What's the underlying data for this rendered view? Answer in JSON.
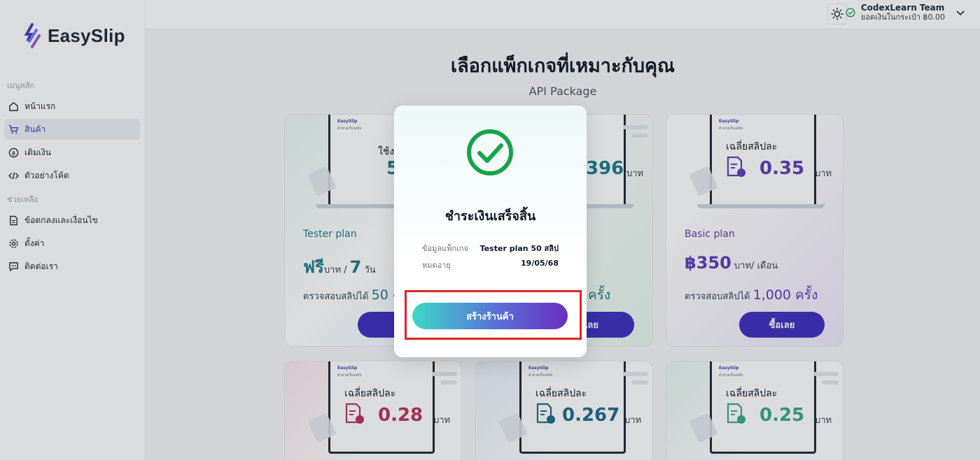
{
  "app": {
    "brand": "EasySlip"
  },
  "sidebar": {
    "sections": [
      {
        "title": "เมนูหลัก"
      },
      {
        "title": "ช่วยเหลือ"
      }
    ],
    "items": [
      {
        "label": "หน้าแรก",
        "icon": "home-icon"
      },
      {
        "label": "สินค้า",
        "icon": "cart-icon",
        "active": true
      },
      {
        "label": "เติมเงิน",
        "icon": "coin-icon"
      },
      {
        "label": "ตัวอย่างโค้ด",
        "icon": "code-icon"
      },
      {
        "label": "ข้อตกลงและเงื่อนไข",
        "icon": "document-icon"
      },
      {
        "label": "ตั้งค่า",
        "icon": "gear-icon"
      },
      {
        "label": "ติดต่อเรา",
        "icon": "chat-icon"
      }
    ]
  },
  "header": {
    "user_name": "CodexLearn Team",
    "balance": "ยอดเงินในกระเป๋า ฿0.00"
  },
  "main": {
    "title": "เลือกแพ็กเกจที่เหมาะกับคุณ",
    "subtitle": "API Package",
    "cards": [
      {
        "mini_logo": "EasySlip",
        "mini_sub": "ตัวช่วยเรื่องสลิป",
        "screen_text": "ใช้งา",
        "screen_value": "5",
        "plan_name": "Tester plan",
        "price": "ฟรี",
        "price_unit": "บาท / ",
        "price_period_value": "7",
        "price_period": " วัน",
        "check_prefix": "ตรวจสอบสลิปได้ ",
        "check_value": "50 ค",
        "buy": "ซื้"
      },
      {
        "screen_value": "396",
        "screen_unit": "บาท",
        "check_value": "ครั้ง",
        "buy": "เลย"
      },
      {
        "mini_logo": "EasySlip",
        "mini_sub": "ตัวช่วยเรื่องสลิป",
        "avg_label": "เฉลี่ยสลิปละ",
        "avg_value": "0.35",
        "avg_unit": "บาท",
        "plan_name": "Basic plan",
        "price": "฿350",
        "price_unit": " บาท/ เดือน",
        "check_prefix": "ตรวจสอบสลิปได้ ",
        "check_value": "1,000 ครั้ง",
        "buy": "ซื้อเลย"
      },
      {
        "mini_logo": "EasySlip",
        "mini_sub": "ตัวช่วยเรื่องสลิป",
        "avg_label": "เฉลี่ยสลิปละ",
        "avg_value": "0.28",
        "avg_unit": "บาท"
      },
      {
        "mini_logo": "EasySlip",
        "mini_sub": "ตัวช่วยเรื่องสลิป",
        "avg_label": "เฉลี่ยสลิปละ",
        "avg_value": "0.267",
        "avg_unit": "บาท"
      },
      {
        "mini_logo": "EasySlip",
        "mini_sub": "ตัวช่วยเรื่องสลิป",
        "avg_label": "เฉลี่ยสลิปละ",
        "avg_value": "0.25",
        "avg_unit": "บาท"
      }
    ]
  },
  "modal": {
    "title": "ชำระเงินเสร็จสิ้น",
    "package_label": "ข้อมูลแพ็กเกจ",
    "package_value": "Tester plan 50 สลิป",
    "expiry_label": "หมดอายุ",
    "expiry_value": "19/05/68",
    "action_label": "สร้างร้านค้า"
  },
  "colors": {
    "accent": "#3f2fc0",
    "teal": "#1f7a8c",
    "success": "#16a34a",
    "highlight": "#e02424",
    "purple_value": "#5b3fb3",
    "pink_value": "#b8345a",
    "mint_value": "#3aa88a"
  }
}
